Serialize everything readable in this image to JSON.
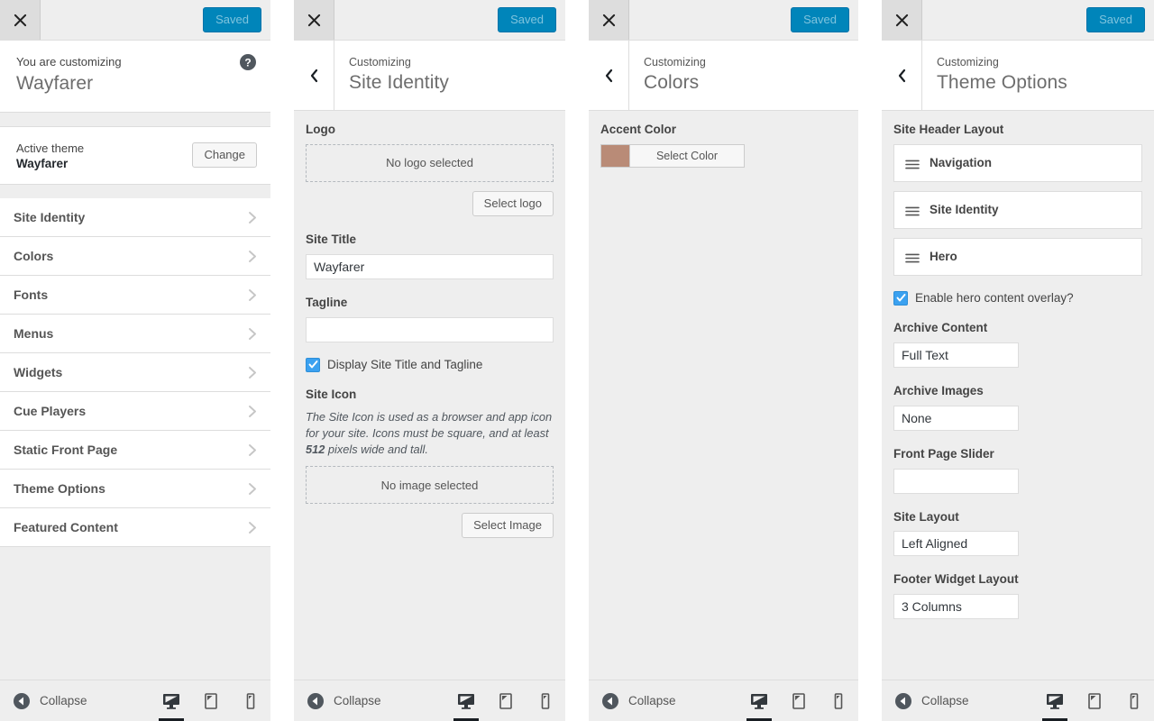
{
  "topbar": {
    "close_label": "Close",
    "saved_label": "Saved",
    "saved_color": "#0085ba"
  },
  "panels": [
    {
      "id": "main",
      "kicker": "You are customizing",
      "title": "Wayfarer",
      "help_label": "Help",
      "active_theme": {
        "label": "Active theme",
        "name": "Wayfarer",
        "change_label": "Change"
      },
      "sections": [
        {
          "label": "Site Identity"
        },
        {
          "label": "Colors"
        },
        {
          "label": "Fonts"
        },
        {
          "label": "Menus"
        },
        {
          "label": "Widgets"
        },
        {
          "label": "Cue Players"
        },
        {
          "label": "Static Front Page"
        },
        {
          "label": "Theme Options"
        },
        {
          "label": "Featured Content"
        }
      ]
    },
    {
      "id": "site-identity",
      "kicker": "Customizing",
      "title": "Site Identity",
      "logo": {
        "label": "Logo",
        "empty_text": "No logo selected",
        "button_label": "Select logo"
      },
      "site_title": {
        "label": "Site Title",
        "value": "Wayfarer"
      },
      "tagline": {
        "label": "Tagline",
        "value": ""
      },
      "display_checkbox": {
        "label": "Display Site Title and Tagline",
        "checked": true
      },
      "site_icon": {
        "label": "Site Icon",
        "description_pre": "The Site Icon is used as a browser and app icon for your site. Icons must be square, and at least ",
        "description_bold": "512",
        "description_post": " pixels wide and tall.",
        "empty_text": "No image selected",
        "button_label": "Select Image"
      }
    },
    {
      "id": "colors",
      "kicker": "Customizing",
      "title": "Colors",
      "accent_color": {
        "label": "Accent Color",
        "swatch_hex": "#b98b77",
        "button_label": "Select Color"
      }
    },
    {
      "id": "theme-options",
      "kicker": "Customizing",
      "title": "Theme Options",
      "site_header_layout": {
        "label": "Site Header Layout",
        "items": [
          {
            "label": "Navigation"
          },
          {
            "label": "Site Identity"
          },
          {
            "label": "Hero"
          }
        ]
      },
      "hero_overlay": {
        "label": "Enable hero content overlay?",
        "checked": true
      },
      "fields": [
        {
          "label": "Archive Content",
          "value": "Full Text"
        },
        {
          "label": "Archive Images",
          "value": "None"
        },
        {
          "label": "Front Page Slider",
          "value": ""
        },
        {
          "label": "Site Layout",
          "value": "Left Aligned"
        },
        {
          "label": "Footer Widget Layout",
          "value": "3 Columns"
        }
      ]
    }
  ],
  "footer": {
    "collapse_label": "Collapse",
    "devices": [
      {
        "name": "desktop",
        "active": true
      },
      {
        "name": "tablet",
        "active": false
      },
      {
        "name": "mobile",
        "active": false
      }
    ]
  }
}
